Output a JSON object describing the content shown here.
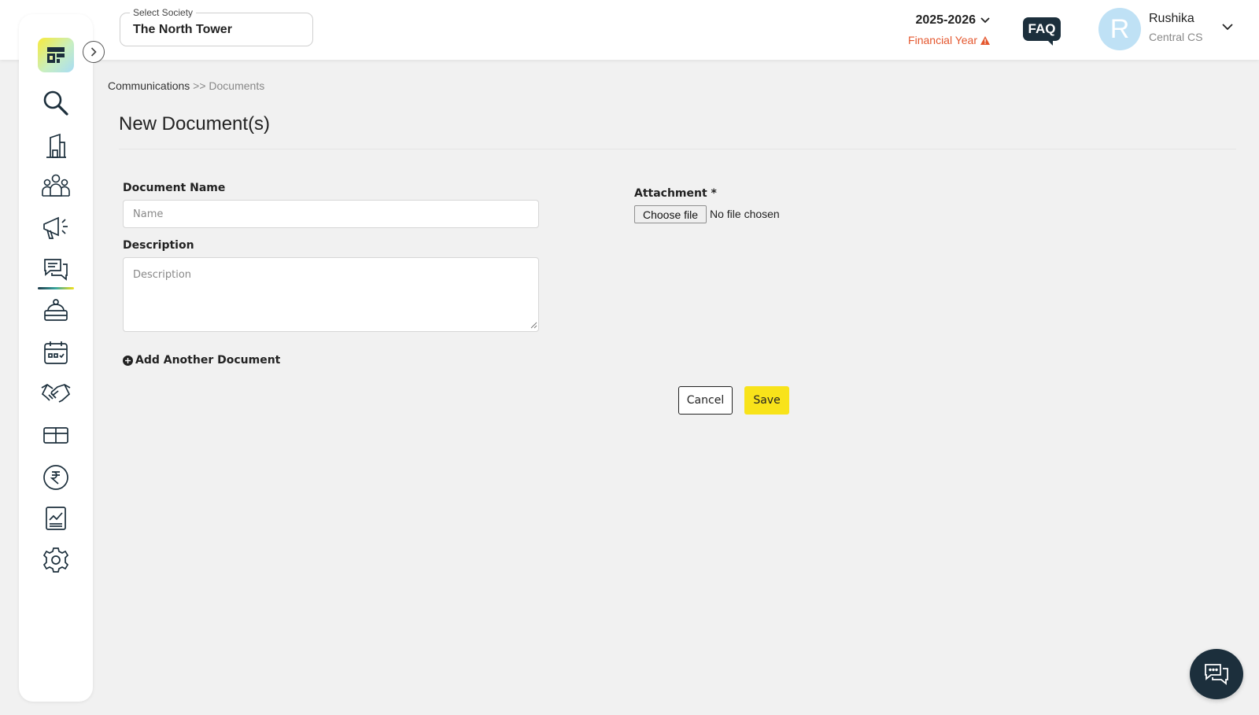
{
  "header": {
    "society": {
      "label": "Select Society",
      "value": "The North Tower"
    },
    "financial_year": {
      "year": "2025-2026",
      "label": "Financial Year"
    },
    "faq_label": "FAQ",
    "user": {
      "initial": "R",
      "name": "Rushika",
      "role": "Central CS"
    }
  },
  "sidebar": {
    "items": [
      {
        "icon": "search-icon"
      },
      {
        "icon": "building-icon"
      },
      {
        "icon": "people-icon"
      },
      {
        "icon": "megaphone-icon"
      },
      {
        "icon": "chat-bubbles-icon",
        "active": true
      },
      {
        "icon": "service-bell-icon"
      },
      {
        "icon": "calendar-icon"
      },
      {
        "icon": "handshake-icon"
      },
      {
        "icon": "box-icon"
      },
      {
        "icon": "rupee-icon"
      },
      {
        "icon": "report-chart-icon"
      },
      {
        "icon": "gear-icon"
      }
    ]
  },
  "breadcrumb": {
    "parent": "Communications",
    "separator": ">>",
    "current": "Documents"
  },
  "page_title": "New Document(s)",
  "form": {
    "document_name": {
      "label": "Document Name",
      "placeholder": "Name",
      "value": ""
    },
    "description": {
      "label": "Description",
      "placeholder": "Description",
      "value": ""
    },
    "attachment": {
      "label": "Attachment *",
      "button": "Choose file",
      "status": "No file chosen"
    },
    "add_another_label": "Add Another Document",
    "cancel_label": "Cancel",
    "save_label": "Save"
  },
  "colors": {
    "accent_yellow": "#f8e31a",
    "dark_navy": "#1c2f3c",
    "warning_orange": "#e4572e",
    "background": "#f1f1f1"
  }
}
